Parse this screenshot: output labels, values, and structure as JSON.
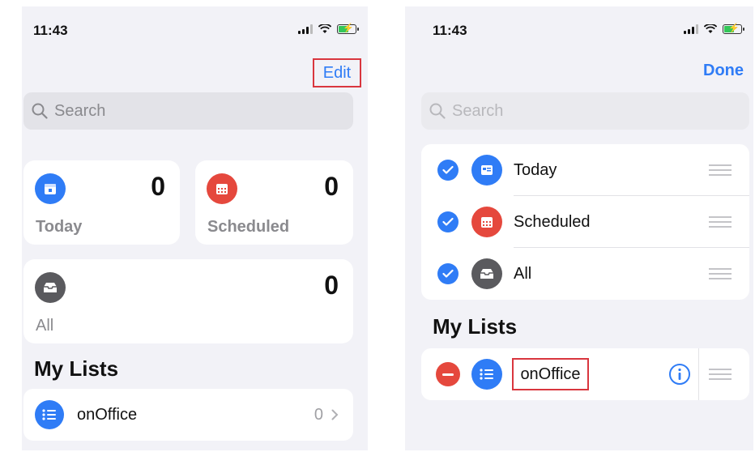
{
  "left": {
    "time": "11:43",
    "edit_label": "Edit",
    "search_placeholder": "Search",
    "smart_lists": {
      "today": {
        "label": "Today",
        "count": "0"
      },
      "scheduled": {
        "label": "Scheduled",
        "count": "0"
      },
      "all": {
        "label": "All",
        "count": "0"
      }
    },
    "my_lists_title": "My Lists",
    "lists": [
      {
        "name": "onOffice",
        "count": "0"
      }
    ]
  },
  "right": {
    "time": "11:43",
    "done_label": "Done",
    "search_placeholder": "Search",
    "smart_lists": [
      {
        "label": "Today"
      },
      {
        "label": "Scheduled"
      },
      {
        "label": "All"
      }
    ],
    "my_lists_title": "My Lists",
    "lists": [
      {
        "name": "onOffice"
      }
    ]
  },
  "colors": {
    "accent": "#2f7cf6",
    "today_icon": "#2f7cf6",
    "scheduled_icon": "#e5483d",
    "all_icon": "#5a5a5e",
    "delete": "#e5483d",
    "highlight": "#d9363e"
  },
  "icons": {
    "today": "calendar-icon",
    "scheduled": "calendar-grid-icon",
    "all": "tray-icon",
    "list": "list-bullet-icon",
    "info": "info-icon",
    "reorder": "reorder-handle-icon",
    "delete": "minus-circle-icon",
    "check": "checkmark-circle-icon"
  }
}
